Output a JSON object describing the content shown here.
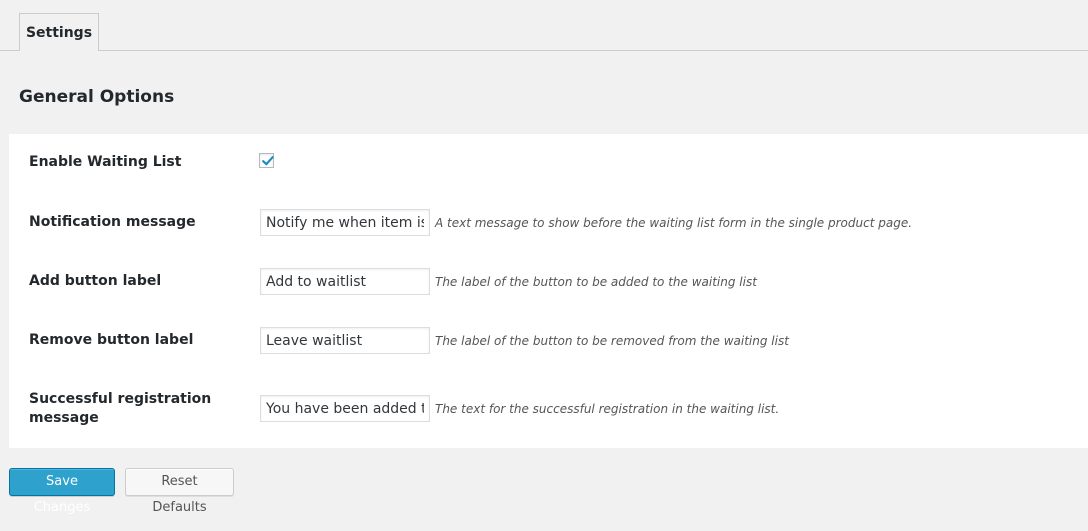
{
  "tabs": [
    {
      "label": "Settings",
      "active": true
    }
  ],
  "section": {
    "title": "General Options"
  },
  "fields": {
    "enable_waiting_list": {
      "label": "Enable Waiting List",
      "checked": true
    },
    "notification_message": {
      "label": "Notification message",
      "value": "Notify me when item is back in stock",
      "description": "A text message to show before the waiting list form in the single product page."
    },
    "add_button_label": {
      "label": "Add button label",
      "value": "Add to waitlist",
      "description": "The label of the button to be added to the waiting list"
    },
    "remove_button_label": {
      "label": "Remove button label",
      "value": "Leave waitlist",
      "description": "The label of the button to be removed from the waiting list"
    },
    "successful_registration_message": {
      "label_line1": "Successful registration",
      "label_line2": "message",
      "value": "You have been added to the waiting list",
      "description": "The text for the successful registration in the waiting list."
    }
  },
  "buttons": {
    "save_label": "Save Changes",
    "reset_label": "Reset Defaults"
  },
  "colors": {
    "page_background": "#f1f1f1",
    "panel_background": "#ffffff",
    "primary_button": "#2ea2cc",
    "checkmark": "#1e8cbe"
  },
  "icons": {
    "checkbox_mark": "checkmark-icon"
  }
}
